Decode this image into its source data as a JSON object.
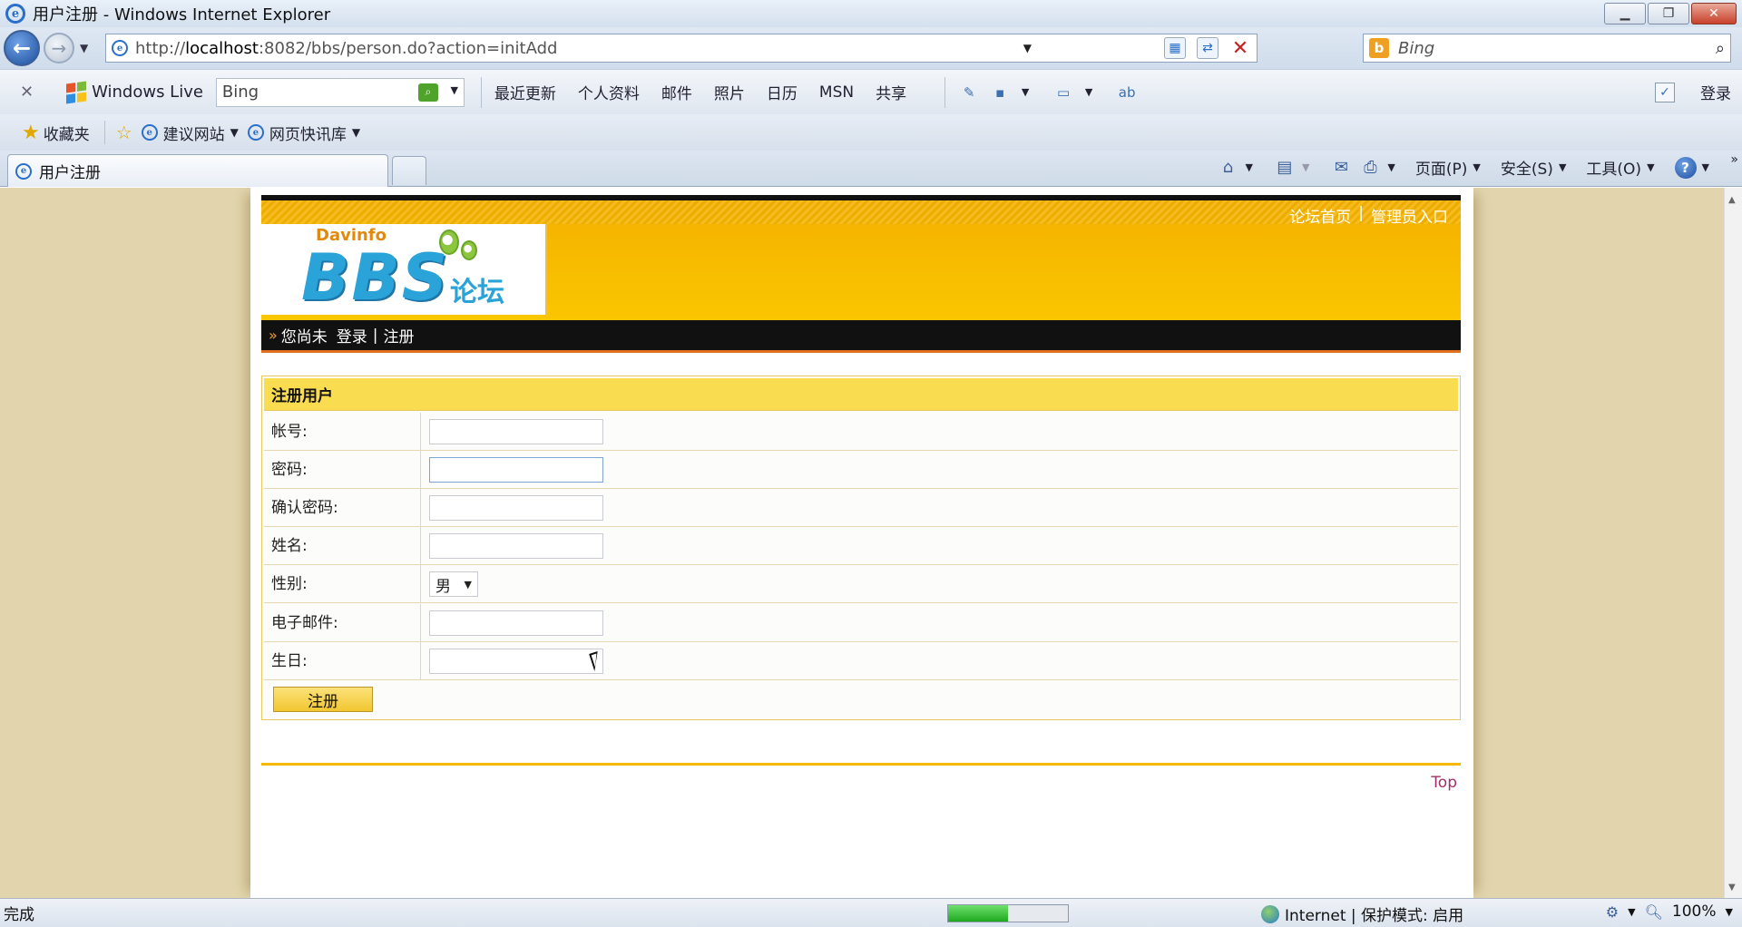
{
  "window": {
    "title": "用户注册 - Windows Internet Explorer",
    "minimize": "▁",
    "restore": "❐",
    "close": "✕"
  },
  "address": {
    "url_prefix": "http://",
    "url_host": "localhost",
    "url_rest": ":8082/bbs/person.do?action=initAdd",
    "search_placeholder": "Bing"
  },
  "live_toolbar": {
    "brand": "Windows Live",
    "search_value": "Bing",
    "links": [
      "最近更新",
      "个人资料",
      "邮件",
      "照片",
      "日历",
      "MSN",
      "共享"
    ],
    "login": "登录"
  },
  "favorites": {
    "label": "收藏夹",
    "items": [
      {
        "label": "建议网站"
      },
      {
        "label": "网页快讯库"
      }
    ]
  },
  "tabs": [
    {
      "label": "用户注册",
      "active": true
    }
  ],
  "command_bar": {
    "page": "页面(P)",
    "safety": "安全(S)",
    "tools": "工具(O)"
  },
  "site": {
    "top_links": [
      "论坛首页",
      "管理员入口"
    ],
    "top_sep": "|",
    "logo": {
      "small": "Davinfo",
      "big": "BBS",
      "cn": "论坛"
    },
    "nav": {
      "arrow": "»",
      "prefix": "您尚未",
      "login": "登录",
      "sep": "|",
      "register": "注册"
    }
  },
  "form": {
    "title": "注册用户",
    "fields": [
      {
        "label": "帐号:",
        "type": "text",
        "value": ""
      },
      {
        "label": "密码:",
        "type": "password",
        "value": ""
      },
      {
        "label": "确认密码:",
        "type": "password",
        "value": ""
      },
      {
        "label": "姓名:",
        "type": "text",
        "value": ""
      },
      {
        "label": "性别:",
        "type": "select",
        "value": "男"
      },
      {
        "label": "电子邮件:",
        "type": "text",
        "value": ""
      },
      {
        "label": "生日:",
        "type": "text",
        "value": ""
      }
    ],
    "submit": "注册"
  },
  "footer": {
    "top_link": "Top"
  },
  "status": {
    "text": "完成",
    "progress": 0.5,
    "zone": "Internet | 保护模式: 启用",
    "zoom": "100%"
  },
  "colors": {
    "header_orange": "#f4b000",
    "form_header": "#fadc50",
    "page_bg": "#e2d5ad",
    "nav_black": "#111111",
    "top_link": "#a0306a"
  }
}
